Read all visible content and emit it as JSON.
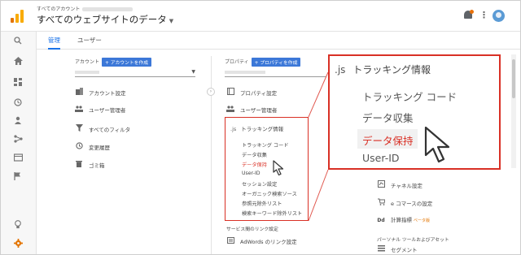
{
  "header": {
    "breadcrumb_label": "すべてのアカウント",
    "title": "すべてのウェブサイトのデータ"
  },
  "tabs": [
    {
      "label": "管理",
      "active": true
    },
    {
      "label": "ユーザー",
      "active": false
    }
  ],
  "account_column": {
    "label": "アカウント",
    "create_button": "+ アカウントを作成",
    "items": [
      {
        "icon": "building-icon",
        "label": "アカウント設定"
      },
      {
        "icon": "users-icon",
        "label": "ユーザー管理者"
      },
      {
        "icon": "filter-icon",
        "label": "すべてのフィルタ"
      },
      {
        "icon": "history-icon",
        "label": "変更履歴"
      },
      {
        "icon": "trash-icon",
        "label": "ゴミ箱"
      }
    ]
  },
  "property_column": {
    "label": "プロパティ",
    "create_button": "+ プロパティを作成",
    "items": [
      {
        "icon": "window-icon",
        "label": "プロパティ設定"
      },
      {
        "icon": "users-icon",
        "label": "ユーザー管理者"
      }
    ],
    "tracking": {
      "js": ".js",
      "label": "トラッキング情報",
      "subitems": [
        "トラッキング コード",
        "データ収集",
        "データ保持",
        "User-ID",
        "セッション設定",
        "オーガニック検索ソース",
        "参照元除外リスト",
        "検索キーワード除外リスト"
      ],
      "highlighted_index": 2
    },
    "service_link_label": "サービス間のリンク設定",
    "adwords_label": "AdWords のリンク設定"
  },
  "view_column": {
    "items": [
      {
        "icon": "channel-icon",
        "label": "チャネル設定"
      },
      {
        "icon": "cart-icon",
        "label": "e コマースの設定"
      }
    ],
    "calc_label": "計算指標",
    "calc_badge": "ベータ版",
    "dd_icon": "Dd",
    "personal_label": "パーソナル ツールおよびアセット",
    "segment_label": "セグメント"
  },
  "zoom": {
    "js": ".js",
    "label": "トラッキング情報",
    "items": [
      "トラッキング コード",
      "データ収集",
      "データ保持",
      "User-ID"
    ],
    "highlighted_index": 2
  },
  "colors": {
    "accent": "#1a73e8",
    "highlight": "#d93025",
    "create_button": "#3c78d8",
    "logo": "#f9ab00"
  }
}
